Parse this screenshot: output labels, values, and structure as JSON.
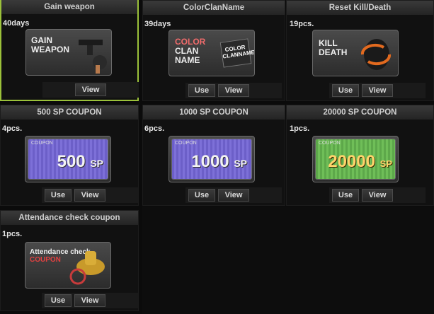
{
  "items": [
    {
      "title": "Gain weapon",
      "qty": "40days",
      "art": [
        "GAIN",
        "WEAPON"
      ],
      "buttons": [
        "View"
      ],
      "selected": true
    },
    {
      "title": "ColorClanName",
      "qty": "39days",
      "art": [
        "COLOR",
        "CLAN",
        "NAME"
      ],
      "tag": "COLOR CLANNAME",
      "buttons": [
        "Use",
        "View"
      ]
    },
    {
      "title": "Reset Kill/Death",
      "qty": "19pcs.",
      "art": [
        "KILL",
        "DEATH"
      ],
      "buttons": [
        "Use",
        "View"
      ]
    },
    {
      "title": "500 SP COUPON",
      "qty": "4pcs.",
      "coupon": "500",
      "buttons": [
        "Use",
        "View"
      ]
    },
    {
      "title": "1000 SP COUPON",
      "qty": "6pcs.",
      "coupon": "1000",
      "buttons": [
        "Use",
        "View"
      ]
    },
    {
      "title": "20000 SP COUPON",
      "qty": "1pcs.",
      "coupon": "20000",
      "buttons": [
        "Use",
        "View"
      ]
    },
    {
      "title": "Attendance check coupon",
      "qty": "1pcs.",
      "art": [
        "Attendance check",
        "COUPON"
      ],
      "buttons": [
        "Use",
        "View"
      ]
    }
  ],
  "coupon_label": "COUPON",
  "sp_unit": "SP",
  "colors": {
    "selected_border": "#9bc13a"
  }
}
